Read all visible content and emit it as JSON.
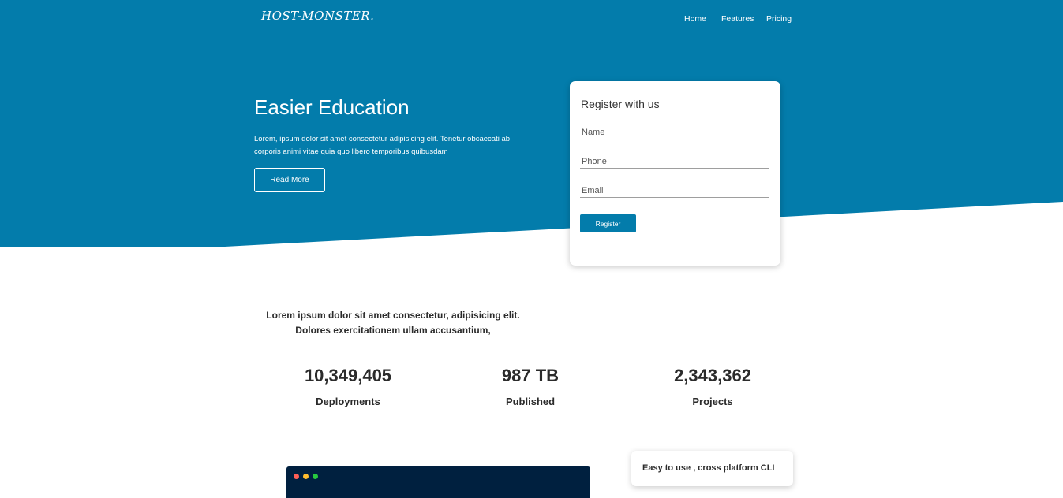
{
  "brand": {
    "logo": "HOST-MONSTER.",
    "primary_color": "#037cab"
  },
  "nav": {
    "home": "Home",
    "features": "Features",
    "pricing": "Pricing"
  },
  "hero": {
    "title": "Easier Education",
    "text": "Lorem, ipsum dolor sit amet consectetur adipisicing elit. Tenetur obcaecati ab corporis animi vitae quia quo libero temporibus quibusdam",
    "cta": "Read More"
  },
  "register": {
    "title": "Register with us",
    "name_placeholder": "Name",
    "phone_placeholder": "Phone",
    "email_placeholder": "Email",
    "button": "Register"
  },
  "intro": "Lorem ipsum dolor sit amet consectetur, adipisicing elit. Dolores exercitationem ullam accusantium,",
  "stats": [
    {
      "value": "10,349,405",
      "label": "Deployments"
    },
    {
      "value": "987 TB",
      "label": "Published"
    },
    {
      "value": "2,343,362",
      "label": "Projects"
    }
  ],
  "terminal": {
    "dot_colors": [
      "#ff5f56",
      "#ffbd2e",
      "#27c93f"
    ]
  },
  "feature_card": {
    "text": "Easy to use , cross platform CLI"
  }
}
